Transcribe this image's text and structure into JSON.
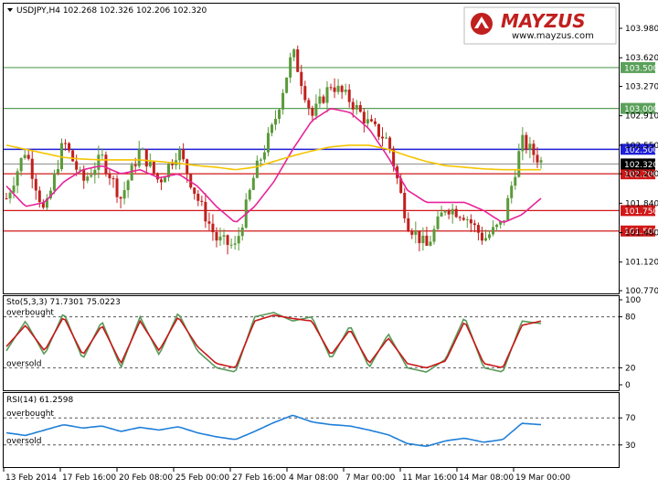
{
  "header": {
    "symbol_line": "USDJPY,H4  102.268 102.326 102.206 102.320"
  },
  "brand": {
    "name": "MAYZUS",
    "url": "www.mayzus.com"
  },
  "chart_data": [
    {
      "type": "candlestick",
      "title": "USDJPY,H4",
      "ohlc_last": {
        "open": 102.268,
        "high": 102.326,
        "low": 102.206,
        "close": 102.32
      },
      "ylim": [
        100.6,
        104.2
      ],
      "y_ticks": [
        103.98,
        103.62,
        103.27,
        102.91,
        102.55,
        102.2,
        101.84,
        101.48,
        101.12,
        100.77
      ],
      "x_ticks": [
        "13 Feb 2014",
        "17 Feb 16:00",
        "20 Feb 08:00",
        "25 Feb 00:00",
        "27 Feb 16:00",
        "4 Mar 08:00",
        "7 Mar 00:00",
        "11 Mar 16:00",
        "14 Mar 08:00",
        "19 Mar 00:00"
      ],
      "price_path": [
        101.9,
        102.5,
        101.7,
        102.6,
        102.1,
        102.4,
        101.9,
        102.5,
        102.1,
        102.5,
        101.9,
        101.4,
        101.3,
        102.2,
        102.8,
        103.7,
        102.9,
        103.3,
        103.1,
        102.8,
        102.6,
        101.6,
        101.3,
        101.8,
        101.7,
        101.4,
        101.6,
        102.6,
        102.35
      ],
      "moving_averages": [
        {
          "color": "#e8249a",
          "values": [
            102.05,
            101.8,
            101.85,
            102.1,
            102.25,
            102.3,
            102.2,
            102.25,
            102.15,
            102.2,
            102.05,
            101.8,
            101.6,
            101.8,
            102.1,
            102.5,
            102.85,
            103.0,
            102.95,
            102.75,
            102.4,
            102.0,
            101.85,
            101.85,
            101.85,
            101.75,
            101.6,
            101.7,
            101.9
          ]
        },
        {
          "color": "#f5c400",
          "values": [
            102.55,
            102.5,
            102.45,
            102.4,
            102.38,
            102.37,
            102.37,
            102.37,
            102.35,
            102.33,
            102.3,
            102.28,
            102.25,
            102.28,
            102.35,
            102.42,
            102.48,
            102.53,
            102.55,
            102.55,
            102.5,
            102.42,
            102.35,
            102.3,
            102.28,
            102.26,
            102.25,
            102.25,
            102.25
          ]
        }
      ],
      "horizontal_levels": [
        {
          "value": 103.5,
          "label": "103.500",
          "color": "#5aa05a"
        },
        {
          "value": 103.0,
          "label": "103.000",
          "color": "#5aa05a"
        },
        {
          "value": 102.5,
          "label": "102.500",
          "color": "#1f1fd6"
        },
        {
          "value": 102.2,
          "label": "102.200",
          "color": "#d01818"
        },
        {
          "value": 101.75,
          "label": "101.750",
          "color": "#d01818"
        },
        {
          "value": 101.5,
          "label": "101.500",
          "color": "#d01818"
        }
      ],
      "current_price": {
        "value": 102.32,
        "label": "102.320"
      }
    },
    {
      "type": "line",
      "title": "Sto(5,3,3) 71.7301 75.0223",
      "ylim": [
        0,
        100
      ],
      "y_ticks": [
        100,
        80,
        20,
        0
      ],
      "levels": [
        {
          "value": 80,
          "label": "overbought"
        },
        {
          "value": 20,
          "label": "oversold"
        }
      ],
      "series": [
        {
          "color": "#5a9a5a",
          "values": [
            40,
            75,
            35,
            85,
            30,
            75,
            20,
            80,
            35,
            85,
            40,
            20,
            15,
            80,
            85,
            75,
            80,
            30,
            70,
            20,
            60,
            20,
            15,
            30,
            80,
            20,
            15,
            75,
            72
          ]
        },
        {
          "color": "#c81818",
          "values": [
            45,
            70,
            40,
            80,
            35,
            70,
            25,
            75,
            40,
            80,
            45,
            25,
            20,
            75,
            82,
            78,
            75,
            35,
            65,
            25,
            55,
            25,
            20,
            28,
            75,
            25,
            20,
            70,
            75
          ]
        }
      ]
    },
    {
      "type": "line",
      "title": "RSI(14) 61.2598",
      "ylim": [
        0,
        100
      ],
      "y_ticks": [
        70,
        30
      ],
      "levels": [
        {
          "value": 70,
          "label": "overbought"
        },
        {
          "value": 30,
          "label": "oversold"
        }
      ],
      "series": [
        {
          "color": "#1e7fd8",
          "values": [
            48,
            44,
            52,
            60,
            55,
            58,
            50,
            56,
            52,
            57,
            48,
            42,
            38,
            50,
            63,
            74,
            64,
            60,
            58,
            52,
            45,
            32,
            28,
            36,
            40,
            34,
            38,
            62,
            60
          ]
        }
      ]
    }
  ]
}
